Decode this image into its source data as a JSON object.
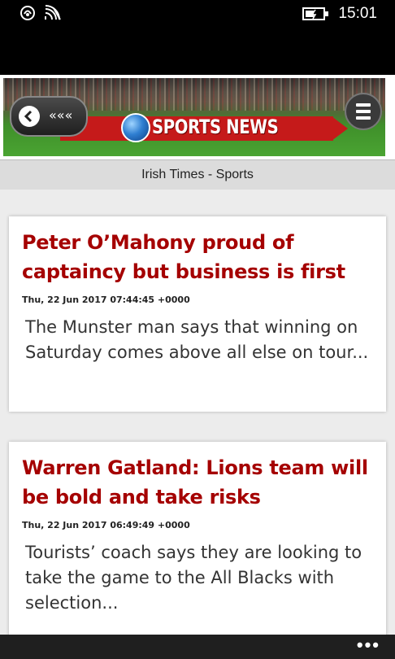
{
  "status_bar": {
    "time": "15:01",
    "icons": [
      "nfc-icon",
      "signal-icon",
      "battery-charging-icon"
    ]
  },
  "banner": {
    "back_label": "«««",
    "brand": "SPORTS NEWS",
    "menu_icon": "hamburger-icon"
  },
  "source": {
    "title": "Irish Times - Sports"
  },
  "articles": [
    {
      "title": "Peter O’Mahony proud of captaincy but business is first",
      "date": "Thu, 22 Jun 2017 07:44:45 +0000",
      "summary": "The Munster man says that winning on Saturday comes above all else on tour..."
    },
    {
      "title": "Warren Gatland: Lions team will be bold and take risks",
      "date": "Thu, 22 Jun 2017 06:49:49 +0000",
      "summary": "Tourists’ coach says they are looking to take the game to the All Blacks with selection..."
    }
  ],
  "app_bar": {
    "more_label": "•••"
  },
  "colors": {
    "title_red": "#a50000",
    "brand_red": "#c51a1a",
    "status_bg": "#000000"
  }
}
